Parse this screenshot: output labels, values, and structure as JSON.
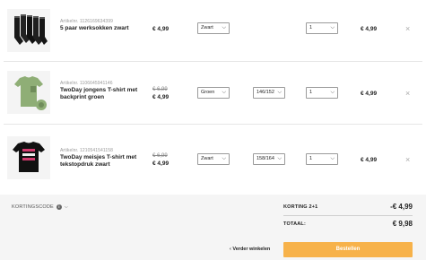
{
  "cart": {
    "items": [
      {
        "article_label": "Artikelnr. 1126169634399",
        "name": "5 paar werksokken zwart",
        "price_old": "",
        "price": "€ 4,99",
        "color": "Zwart",
        "size": "",
        "quantity": "1",
        "total": "€ 4,99",
        "image": "black-socks-image"
      },
      {
        "article_label": "Artikelnr. 1106645941146",
        "name": "TwoDay jongens T-shirt met backprint groen",
        "price_old": "€ 6,99",
        "price": "€ 4,99",
        "color": "Groen",
        "size": "146/152",
        "quantity": "1",
        "total": "€ 4,99",
        "image": "green-tshirt-image"
      },
      {
        "article_label": "Artikelnr. 1210541541158",
        "name": "TwoDay meisjes T-shirt met tekstopdruk zwart",
        "price_old": "€ 6,99",
        "price": "€ 4,99",
        "color": "Zwart",
        "size": "158/164",
        "quantity": "1",
        "total": "€ 4,99",
        "image": "black-tshirt-image"
      }
    ]
  },
  "footer": {
    "coupon_label": "KORTINGSCODE",
    "discount_label": "KORTING 2+1",
    "discount_value": "-€ 4,99",
    "total_label": "TOTAAL:",
    "total_value": "€ 9,98",
    "back_label": "Verder winkelen",
    "checkout_label": "Bestellen"
  },
  "icons": {
    "remove": "×",
    "chevron": "⌵",
    "back_chevron": "‹",
    "info": "i"
  },
  "colors": {
    "accent": "#f7b24a",
    "footer_bg": "#f5f5f5"
  }
}
